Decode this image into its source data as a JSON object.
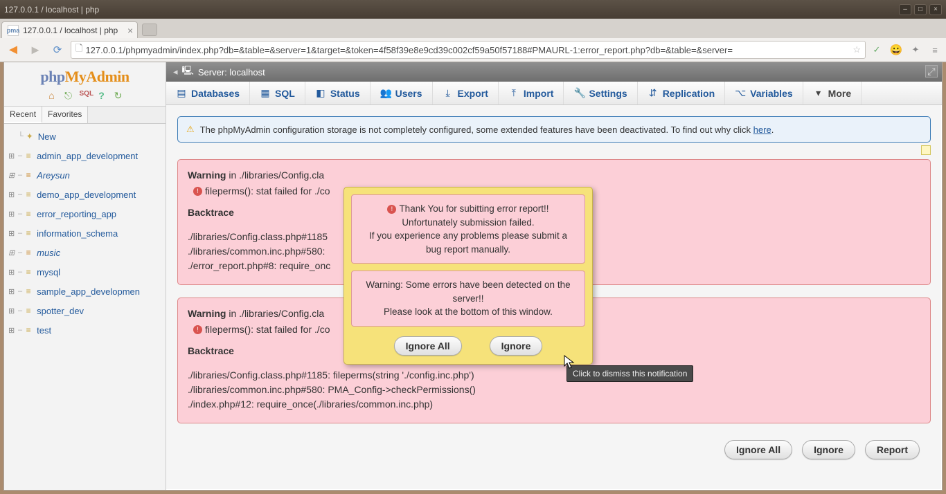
{
  "os_title": "127.0.0.1 / localhost | php",
  "browser": {
    "tab_title": "127.0.0.1 / localhost | php",
    "url": "127.0.0.1/phpmyadmin/index.php?db=&table=&server=1&target=&token=4f58f39e8e9cd39c002cf59a50f57188#PMAURL-1:error_report.php?db=&table=&server="
  },
  "logo": {
    "p1": "php",
    "p2": "My",
    "p3": "Admin"
  },
  "sidebar_tabs": {
    "recent": "Recent",
    "favorites": "Favorites"
  },
  "tree": {
    "new": "New",
    "items": [
      "admin_app_development",
      "Areysun",
      "demo_app_development",
      "error_reporting_app",
      "information_schema",
      "music",
      "mysql",
      "sample_app_developmen",
      "spotter_dev",
      "test"
    ]
  },
  "server_label": "Server: localhost",
  "nav": {
    "databases": "Databases",
    "sql": "SQL",
    "status": "Status",
    "users": "Users",
    "export": "Export",
    "import": "Import",
    "settings": "Settings",
    "replication": "Replication",
    "variables": "Variables",
    "more": "More"
  },
  "config_notice": {
    "text": "The phpMyAdmin configuration storage is not completely configured, some extended features have been deactivated. To find out why click ",
    "link": "here"
  },
  "error1": {
    "prefix": "Warning",
    "in": " in ",
    "file": "./libraries/Config.cla",
    "msg": "fileperms(): stat failed for ./co",
    "bt_title": "Backtrace",
    "trace": "./libraries/Config.class.php#1185\n./libraries/common.inc.php#580:\n./error_report.php#8: require_onc"
  },
  "error2": {
    "prefix": "Warning",
    "in": " in ",
    "file": "./libraries/Config.cla",
    "msg": "fileperms(): stat failed for ./co",
    "bt_title": "Backtrace",
    "trace": "./libraries/Config.class.php#1185: fileperms(string './config.inc.php')\n./libraries/common.inc.php#580: PMA_Config->checkPermissions()\n./index.php#12: require_once(./libraries/common.inc.php)"
  },
  "modal": {
    "msg1": "Thank You for subitting error report!!\nUnfortunately submission failed.\nIf you experience any problems please submit a bug report manually.",
    "msg2": "Warning: Some errors have been detected on the server!!\nPlease look at the bottom of this window.",
    "ignore_all": "Ignore All",
    "ignore": "Ignore"
  },
  "footer": {
    "ignore_all": "Ignore All",
    "ignore": "Ignore",
    "report": "Report"
  },
  "tooltip": "Click to dismiss this notification"
}
